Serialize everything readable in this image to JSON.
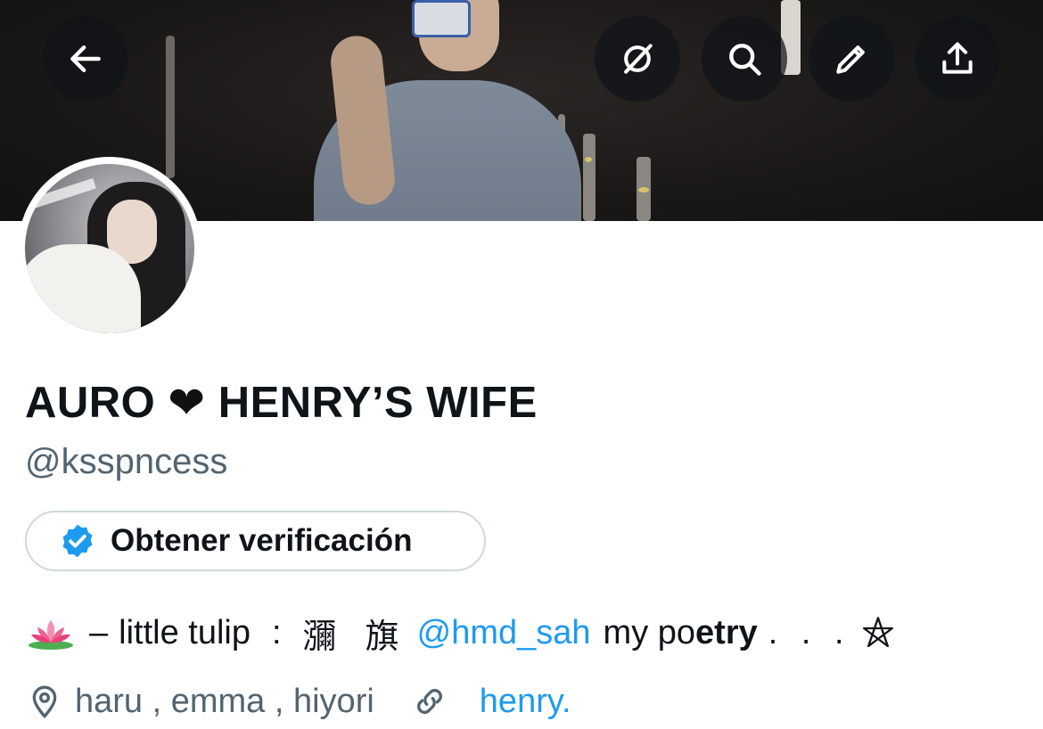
{
  "header": {
    "back_icon": "arrow-left-icon",
    "buttons": [
      {
        "icon": "grok-slash-circle-icon"
      },
      {
        "icon": "search-icon"
      },
      {
        "icon": "pencil-icon"
      },
      {
        "icon": "share-upload-icon"
      }
    ]
  },
  "profile": {
    "display_name_part1": "AURO",
    "heart": "❤",
    "display_name_part2": "HENRY’S WIFE",
    "handle": "@ksspncess",
    "verify_button_label": "Obtener verificación",
    "bio": {
      "emoji": "lotus-emoji",
      "dash": "–",
      "text1": "little tulip",
      "sep": ":",
      "cjk": "瀰 旗",
      "mention": "@hmd_sah",
      "text2": "my po",
      "text2_bold": "etry",
      "dots": ". . .",
      "symbol": "pentagram-icon"
    },
    "location": "haru , emma , hiyori",
    "link": "henry."
  },
  "colors": {
    "accent": "#1d9bf0",
    "secondary_text": "#536471",
    "verify_badge": "#1d9bf0"
  }
}
